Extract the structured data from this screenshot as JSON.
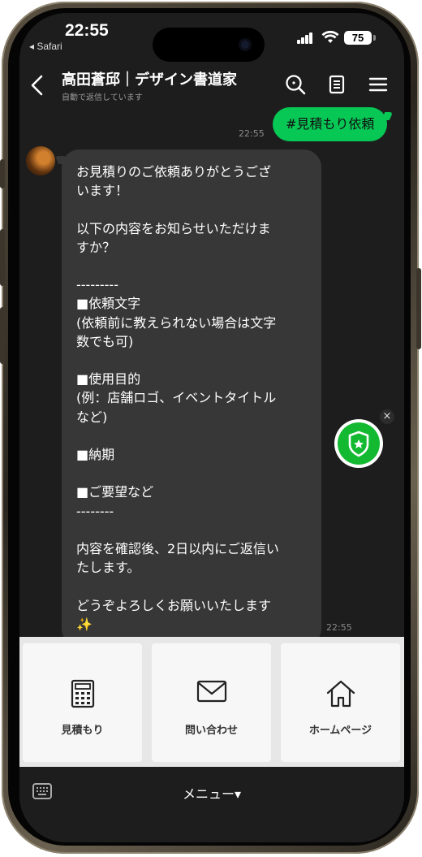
{
  "status": {
    "time": "22:55",
    "back_app": "◂ Safari",
    "battery": "75"
  },
  "header": {
    "title": "高田蒼邱｜デザイン書道家",
    "subtitle": "自動で返信しています",
    "icons": [
      "search-icon",
      "note-icon",
      "menu-icon"
    ]
  },
  "chat": {
    "sent": {
      "text": "#見積もり依頼",
      "time": "22:55"
    },
    "received": {
      "text": "お見積りのご依頼ありがとうござ\nいます！\n\n以下の内容をお知らせいただけま\nすか？\n\n---------\n■依頼文字\n(依頼前に教えられない場合は文字\n数でも可)\n\n■使用目的\n(例：店舗ロゴ、イベントタイトル\nなど)\n\n■納期\n\n■ご要望など\n--------\n\n内容を確認後、2日以内にご返信い\nたします。\n\nどうぞよろしくお願いいたします\n✨",
      "time": "22:55"
    }
  },
  "rich_menu": {
    "items": [
      {
        "label": "見積もり",
        "icon": "calculator-icon"
      },
      {
        "label": "問い合わせ",
        "icon": "envelope-icon"
      },
      {
        "label": "ホームページ",
        "icon": "home-icon"
      }
    ]
  },
  "bottom_bar": {
    "menu_label": "メニュー▾",
    "icon": "keyboard-icon"
  },
  "colors": {
    "accent": "#07c755",
    "badge": "#13b931",
    "bubble": "#373737",
    "background": "#1d1d1d"
  }
}
